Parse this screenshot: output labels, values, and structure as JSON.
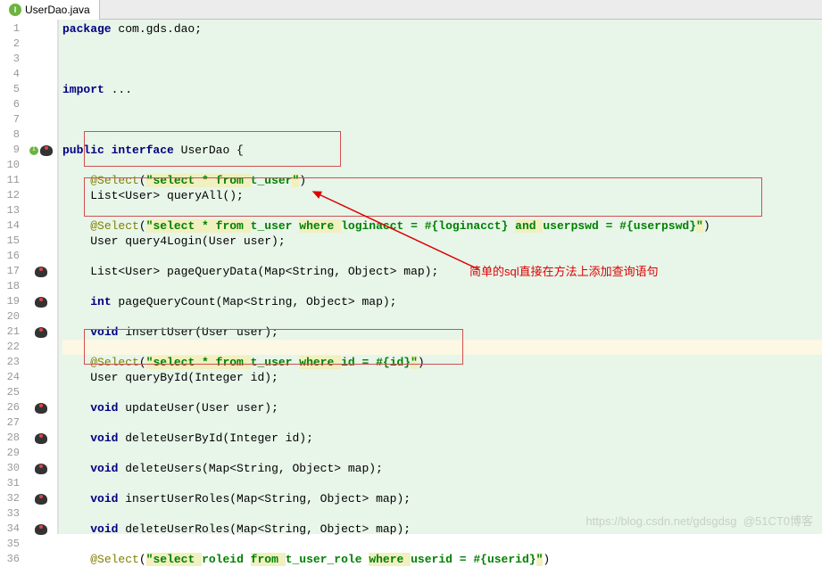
{
  "tab": {
    "filename": "UserDao.java"
  },
  "gutter": {
    "start": 1,
    "end": 36
  },
  "code": {
    "l1": {
      "kw": "package",
      "rest": " com.gds.dao;"
    },
    "l5": {
      "kw": "import",
      "rest": " ..."
    },
    "l9": {
      "kw1": "public",
      "kw2": "interface",
      "name": " UserDao {"
    },
    "l11": {
      "ann": "@Select",
      "open": "(",
      "s1": "\"select * from ",
      "s2": "t_user",
      "s3": "\"",
      "close": ")"
    },
    "l12": "List<User> queryAll();",
    "l14": {
      "ann": "@Select",
      "open": "(",
      "s1": "\"select * from ",
      "s2": "t_user ",
      "s3": "where ",
      "s4": "loginacct = #{loginacct} ",
      "s5": "and ",
      "s6": "userpswd = #{userpswd}",
      "s7": "\"",
      "close": ")"
    },
    "l15": "User query4Login(User user);",
    "l17": "List<User> pageQueryData(Map<String, Object> map);",
    "l19": {
      "kw": "int",
      "rest": " pageQueryCount(Map<String, Object> map);"
    },
    "l21": {
      "kw": "void",
      "rest": " insertUser(User user);"
    },
    "l23": {
      "ann": "@Select",
      "open": "(",
      "s1": "\"select * from ",
      "s2": "t_user ",
      "s3": "where ",
      "s4": "id = #{id}",
      "s5": "\"",
      "close": ")"
    },
    "l24": "User queryById(Integer id);",
    "l26": {
      "kw": "void",
      "rest": " updateUser(User user);"
    },
    "l28": {
      "kw": "void",
      "rest": " deleteUserById(Integer id);"
    },
    "l30": {
      "kw": "void",
      "rest": " deleteUsers(Map<String, Object> map);"
    },
    "l32": {
      "kw": "void",
      "rest": " insertUserRoles(Map<String, Object> map);"
    },
    "l34": {
      "kw": "void",
      "rest": " deleteUserRoles(Map<String, Object> map);"
    },
    "l36": {
      "ann": "@Select",
      "open": "(",
      "s1": "\"select ",
      "s2": "roleid ",
      "s3": "from ",
      "s4": "t_user_role ",
      "s5": "where ",
      "s6": "userid = #{userid}",
      "s7": "\"",
      "close": ")"
    }
  },
  "annotation": {
    "text": "简单的sql直接在方法上添加查询语句"
  },
  "watermark": {
    "url": "https://blog.csdn.net/gdsgdsg",
    "brand": "@51CT0博客"
  }
}
